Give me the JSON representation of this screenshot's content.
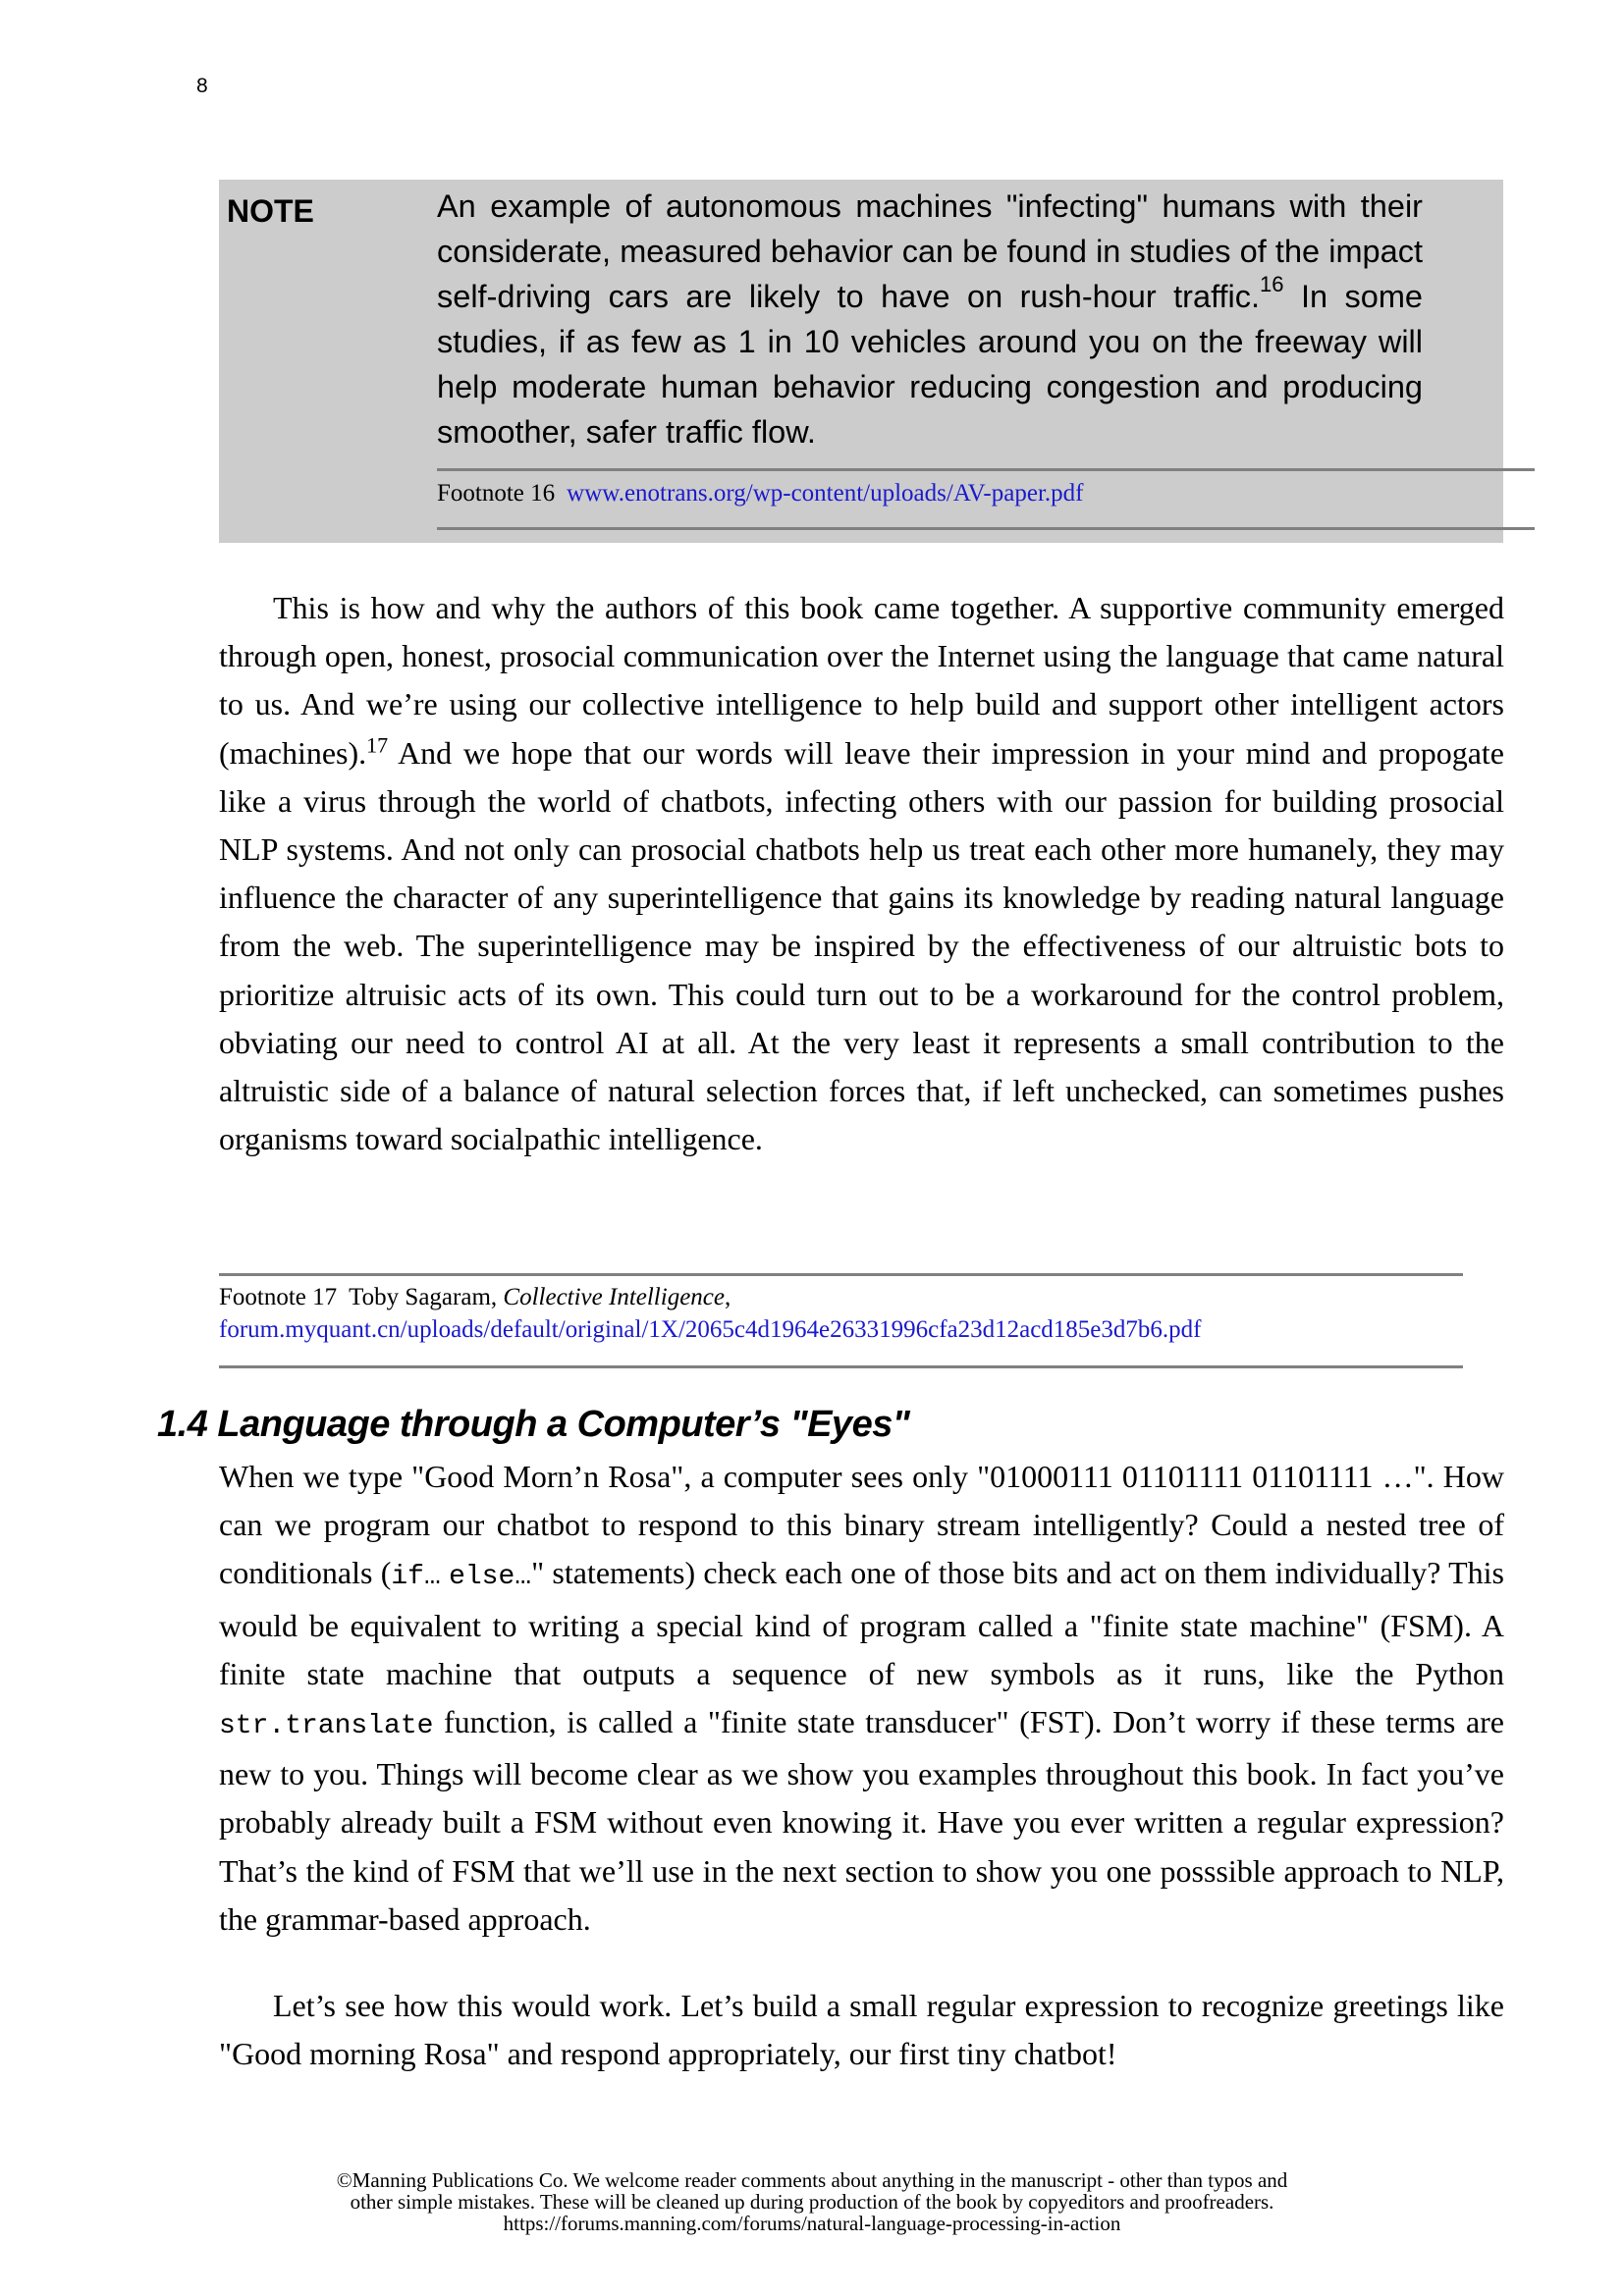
{
  "page_number": "8",
  "note": {
    "label": "NOTE",
    "text_before_ref": "An example of autonomous machines \"infecting\" humans with their considerate, measured behavior can be found in studies of the impact self-driving cars are likely to have on rush-hour traffic.",
    "ref": "16",
    "text_after_ref": " In some studies, if as few as 1 in 10 vehicles around you on the freeway will help moderate human behavior reducing congestion and producing smoother, safer traffic flow.",
    "footnote": {
      "label": "Footnote 16",
      "link": "www.enotrans.org/wp-content/uploads/AV-paper.pdf"
    }
  },
  "paragraph_1": {
    "text_before_ref": "This is how and why the authors of this book came together. A supportive community emerged through open, honest, prosocial communication over the Internet using the language that came natural to us. And we’re using our collective intelligence to help build and support other intelligent actors (machines).",
    "ref": "17",
    "text_after_ref": " And we hope that our words will leave their impression in your mind and propogate like a virus through the world of chatbots, infecting others with our passion for building prosocial NLP systems. And not only can prosocial chatbots help us treat each other more humanely, they may influence the character of any superintelligence that gains its knowledge by reading natural language from the web. The superintelligence may be inspired by the effectiveness of our altruistic bots to prioritize altruisic acts of its own. This could turn out to be a workaround for the control problem, obviating our need to control AI at all. At the very least it represents a small contribution to the altruistic side of a balance of natural selection forces that, if left unchecked, can sometimes pushes organisms toward socialpathic intelligence."
  },
  "footnote_17": {
    "label": "Footnote 17",
    "author": "Toby Sagaram, ",
    "title": "Collective Intelligence",
    "title_suffix": ",",
    "link": "forum.myquant.cn/uploads/default/original/1X/2065c4d1964e26331996cfa23d12acd185e3d7b6.pdf"
  },
  "section": {
    "heading": "1.4 Language through a Computer’s \"Eyes\"",
    "paragraph_2": {
      "part_1": "When we type \"Good Morn’n Rosa\", a computer sees only \"01000111 01101111 01101111 …\". How can we program our chatbot to respond to this binary stream intelligently? Could a nested tree of conditionals (",
      "code_1": "if…",
      "part_2": " ",
      "code_2": "else…",
      "part_3": "\" statements) check each one of those bits and act on them individually? This would be equivalent to writing a special kind of program called a \"finite state machine\" (FSM). A finite state machine that outputs a sequence of new symbols as it runs, like the Python ",
      "code_3": "str.translate",
      "part_4": " function, is called a \"finite state transducer\" (FST). Don’t worry if these terms are new to you. Things will become clear as we show you examples throughout this book. In fact you’ve probably already built a FSM without even knowing it. Have you ever written a regular expression? That’s the kind of FSM that we’ll use in the next section to show you one posssible approach to NLP, the grammar-based approach."
    },
    "paragraph_3": "Let’s see how this would work. Let’s build a small regular expression to recognize greetings like \"Good morning Rosa\" and respond appropriately, our first tiny chatbot!"
  },
  "footer": {
    "line_1": "©Manning Publications Co. We welcome reader comments about anything in the manuscript - other than typos and",
    "line_2": "other simple mistakes. These will be cleaned up during production of the book by copyeditors and proofreaders.",
    "line_3": "https://forums.manning.com/forums/natural-language-processing-in-action"
  },
  "colors": {
    "note_background": "#cccccc",
    "rule": "#808080",
    "link": "#1a1acc"
  }
}
